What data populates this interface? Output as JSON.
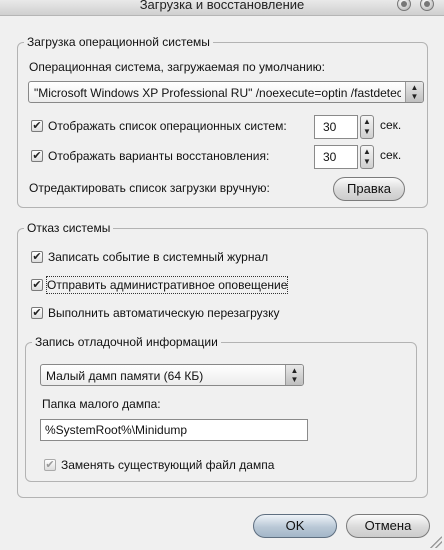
{
  "window": {
    "title": "Загрузка и восстановление"
  },
  "startup": {
    "legend": "Загрузка операционной системы",
    "default_os_label": "Операционная система, загружаемая по умолчанию:",
    "default_os_value": "\"Microsoft Windows XP Professional RU\" /noexecute=optin /fastdetect",
    "show_os_list_label": "Отображать список операционных систем:",
    "show_os_list_checked": true,
    "show_os_list_seconds": "30",
    "show_recovery_label": "Отображать варианты восстановления:",
    "show_recovery_checked": true,
    "show_recovery_seconds": "30",
    "seconds_unit": "сек.",
    "edit_label": "Отредактировать список загрузки вручную:",
    "edit_button": "Правка"
  },
  "failure": {
    "legend": "Отказ системы",
    "write_event_label": "Записать событие в системный журнал",
    "write_event_checked": true,
    "send_alert_label": "Отправить административное оповещение",
    "send_alert_checked": true,
    "auto_restart_label": "Выполнить автоматическую перезагрузку",
    "auto_restart_checked": true
  },
  "debug": {
    "legend": "Запись отладочной информации",
    "dump_type": "Малый дамп памяти (64 КБ)",
    "dump_folder_label": "Папка малого дампа:",
    "dump_folder_value": "%SystemRoot%\\Minidump",
    "overwrite_label": "Заменять существующий файл дампа",
    "overwrite_checked": true,
    "overwrite_enabled": false
  },
  "buttons": {
    "ok": "OK",
    "cancel": "Отмена"
  },
  "glyphs": {
    "check": "✔",
    "up": "▲",
    "down": "▼"
  }
}
